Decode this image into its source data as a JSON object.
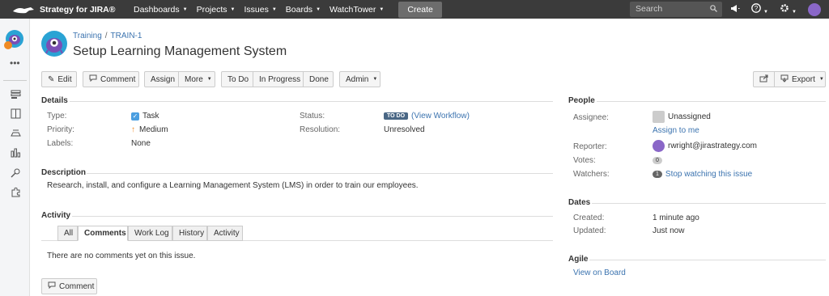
{
  "topnav": {
    "logo_text": "Strategy for JIRA®",
    "items": [
      {
        "label": "Dashboards"
      },
      {
        "label": "Projects"
      },
      {
        "label": "Issues"
      },
      {
        "label": "Boards"
      },
      {
        "label": "WatchTower"
      }
    ],
    "create_label": "Create",
    "search_placeholder": "Search"
  },
  "breadcrumb": {
    "project": "Training",
    "issue_key": "TRAIN-1"
  },
  "issue": {
    "title": "Setup Learning Management System"
  },
  "toolbar": {
    "edit": "Edit",
    "comment": "Comment",
    "assign": "Assign",
    "more": "More",
    "todo": "To Do",
    "in_progress": "In Progress",
    "done": "Done",
    "admin": "Admin",
    "export": "Export"
  },
  "details": {
    "title": "Details",
    "type_label": "Type:",
    "type_value": "Task",
    "priority_label": "Priority:",
    "priority_value": "Medium",
    "labels_label": "Labels:",
    "labels_value": "None",
    "status_label": "Status:",
    "status_lozenge": "TO DO",
    "status_workflow": "(View Workflow)",
    "resolution_label": "Resolution:",
    "resolution_value": "Unresolved"
  },
  "description": {
    "title": "Description",
    "text": "Research, install, and configure a Learning Management System (LMS) in order to train our employees."
  },
  "activity": {
    "title": "Activity",
    "tabs": [
      "All",
      "Comments",
      "Work Log",
      "History",
      "Activity"
    ],
    "active_tab": "Comments",
    "empty_text": "There are no comments yet on this issue.",
    "comment_button": "Comment"
  },
  "people": {
    "title": "People",
    "assignee_label": "Assignee:",
    "assignee_value": "Unassigned",
    "assign_to_me": "Assign to me",
    "reporter_label": "Reporter:",
    "reporter_value": "rwright@jirastrategy.com",
    "votes_label": "Votes:",
    "votes_count": "0",
    "watchers_label": "Watchers:",
    "watchers_count": "1",
    "watchers_link": "Stop watching this issue"
  },
  "dates": {
    "title": "Dates",
    "created_label": "Created:",
    "created_value": "1 minute ago",
    "updated_label": "Updated:",
    "updated_value": "Just now"
  },
  "agile": {
    "title": "Agile",
    "link": "View on Board"
  },
  "colors": {
    "topbar": "#3b3b3b",
    "link": "#3b73af",
    "lozenge": "#4a6785"
  }
}
